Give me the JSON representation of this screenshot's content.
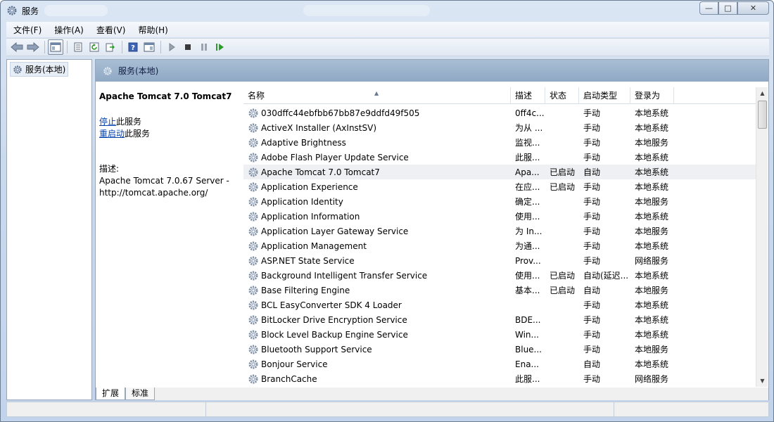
{
  "window": {
    "title": "服务",
    "minimize": "—",
    "maximize": "□",
    "close": "✕"
  },
  "menu": {
    "items": [
      "文件(F)",
      "操作(A)",
      "查看(V)",
      "帮助(H)"
    ]
  },
  "tree": {
    "label": "服务(本地)"
  },
  "main": {
    "header": "服务(本地)",
    "selected_service": "Apache Tomcat 7.0 Tomcat7",
    "stop_link": "停止",
    "stop_suffix": "此服务",
    "restart_link": "重启动",
    "restart_suffix": "此服务",
    "desc_label": "描述:",
    "desc_line1": "Apache Tomcat 7.0.67 Server -",
    "desc_line2": "http://tomcat.apache.org/"
  },
  "columns": {
    "name": "名称",
    "desc": "描述",
    "status": "状态",
    "start": "启动类型",
    "logon": "登录为"
  },
  "rows": [
    {
      "name": "030dffc44ebfbb67bb87e9ddfd49f505",
      "desc": "0ff4c...",
      "status": "",
      "start": "手动",
      "logon": "本地系统"
    },
    {
      "name": "ActiveX Installer (AxInstSV)",
      "desc": "为从 ...",
      "status": "",
      "start": "手动",
      "logon": "本地系统"
    },
    {
      "name": "Adaptive Brightness",
      "desc": "监视...",
      "status": "",
      "start": "手动",
      "logon": "本地服务"
    },
    {
      "name": "Adobe Flash Player Update Service",
      "desc": "此服...",
      "status": "",
      "start": "手动",
      "logon": "本地系统"
    },
    {
      "name": "Apache Tomcat 7.0 Tomcat7",
      "desc": "Apa...",
      "status": "已启动",
      "start": "自动",
      "logon": "本地系统"
    },
    {
      "name": "Application Experience",
      "desc": "在应...",
      "status": "已启动",
      "start": "手动",
      "logon": "本地系统"
    },
    {
      "name": "Application Identity",
      "desc": "确定...",
      "status": "",
      "start": "手动",
      "logon": "本地服务"
    },
    {
      "name": "Application Information",
      "desc": "使用...",
      "status": "",
      "start": "手动",
      "logon": "本地系统"
    },
    {
      "name": "Application Layer Gateway Service",
      "desc": "为 In...",
      "status": "",
      "start": "手动",
      "logon": "本地服务"
    },
    {
      "name": "Application Management",
      "desc": "为通...",
      "status": "",
      "start": "手动",
      "logon": "本地系统"
    },
    {
      "name": "ASP.NET State Service",
      "desc": "Prov...",
      "status": "",
      "start": "手动",
      "logon": "网络服务"
    },
    {
      "name": "Background Intelligent Transfer Service",
      "desc": "使用...",
      "status": "已启动",
      "start": "自动(延迟...",
      "logon": "本地系统"
    },
    {
      "name": "Base Filtering Engine",
      "desc": "基本...",
      "status": "已启动",
      "start": "自动",
      "logon": "本地服务"
    },
    {
      "name": "BCL EasyConverter SDK 4 Loader",
      "desc": "",
      "status": "",
      "start": "手动",
      "logon": "本地系统"
    },
    {
      "name": "BitLocker Drive Encryption Service",
      "desc": "BDE...",
      "status": "",
      "start": "手动",
      "logon": "本地系统"
    },
    {
      "name": "Block Level Backup Engine Service",
      "desc": "Win...",
      "status": "",
      "start": "手动",
      "logon": "本地系统"
    },
    {
      "name": "Bluetooth Support Service",
      "desc": "Blue...",
      "status": "",
      "start": "手动",
      "logon": "本地服务"
    },
    {
      "name": "Bonjour Service",
      "desc": "Ena...",
      "status": "",
      "start": "自动",
      "logon": "本地系统"
    },
    {
      "name": "BranchCache",
      "desc": "此服...",
      "status": "",
      "start": "手动",
      "logon": "网络服务"
    }
  ],
  "tabs": [
    "扩展",
    "标准"
  ]
}
